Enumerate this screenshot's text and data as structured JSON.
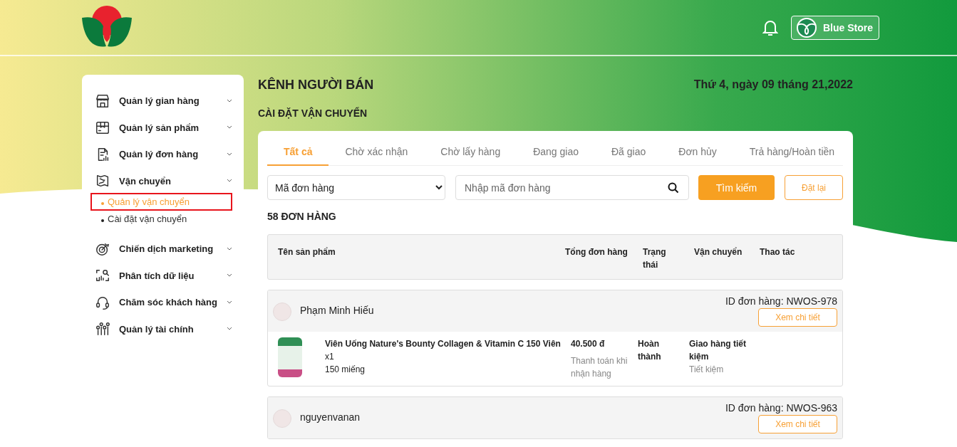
{
  "header": {
    "store_name": "Blue Store"
  },
  "sidebar": {
    "items": [
      {
        "label": "Quản lý gian hàng"
      },
      {
        "label": "Quản lý sản phẩm"
      },
      {
        "label": "Quản lý đơn hàng"
      },
      {
        "label": "Vận chuyển",
        "children": [
          {
            "label": "Quản lý vận chuyển",
            "selected": true
          },
          {
            "label": "Cài đặt vận chuyển",
            "selected": false
          }
        ]
      },
      {
        "label": "Chiến dịch marketing"
      },
      {
        "label": "Phân tích dữ liệu"
      },
      {
        "label": "Chăm sóc khách hàng"
      },
      {
        "label": "Quản lý tài chính"
      }
    ]
  },
  "page": {
    "title": "KÊNH NGƯỜI BÁN",
    "date": "Thứ 4, ngày 09 tháng 21,2022",
    "section_title": "CÀI ĐẶT VẬN CHUYỂN"
  },
  "tabs": [
    {
      "label": "Tất cả",
      "selected": true
    },
    {
      "label": "Chờ xác nhận",
      "selected": false
    },
    {
      "label": "Chờ lấy hàng",
      "selected": false
    },
    {
      "label": "Đang giao",
      "selected": false
    },
    {
      "label": "Đã giao",
      "selected": false
    },
    {
      "label": "Đơn hủy",
      "selected": false
    },
    {
      "label": "Trả hàng/Hoàn tiền",
      "selected": false
    }
  ],
  "filter": {
    "select_value": "Mã đơn hàng",
    "search_placeholder": "Nhập mã đơn hàng",
    "search_button": "Tìm kiếm",
    "reset_button": "Đặt lại"
  },
  "order_count": "58 ĐƠN HÀNG",
  "table": {
    "columns": [
      "Tên sản phẩm",
      "Tổng đơn hàng",
      "Trạng thái",
      "Vận chuyển",
      "Thao tác"
    ]
  },
  "orders": [
    {
      "customer": "Phạm Minh Hiếu",
      "order_id": "ID đơn hàng: NWOS-978",
      "detail_button": "Xem chi tiết",
      "items": [
        {
          "name": "Viên Uống Nature's Bounty Collagen & Vitamin C 150 Viên",
          "quantity": "x1",
          "variant": "150 miếng",
          "price": "40.500 đ",
          "payment": "Thanh toán khi nhận hàng",
          "status": "Hoàn thành",
          "shipping": "Giao hàng tiết kiệm",
          "shipping_type": "Tiết kiệm"
        }
      ]
    },
    {
      "customer": "nguyenvanan",
      "order_id": "ID đơn hàng: NWOS-963",
      "detail_button": "Xem chi tiết"
    }
  ]
}
